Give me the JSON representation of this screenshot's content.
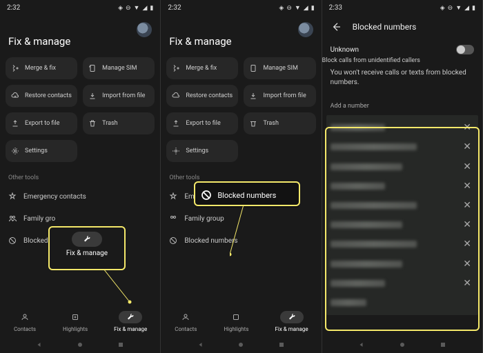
{
  "status": {
    "time1": "2:32",
    "time2": "2:32",
    "time3": "2:33"
  },
  "heading": "Fix & manage",
  "cards": {
    "merge": "Merge & fix",
    "sim": "Manage SIM",
    "restore": "Restore contacts",
    "import": "Import from file",
    "export": "Export to file",
    "trash": "Trash",
    "settings": "Settings"
  },
  "other_label": "Other tools",
  "rows": {
    "emergency": "Emergency contacts",
    "family": "Family group",
    "family_short": "Family gro",
    "blocked": "Blocked numbers",
    "blocked_short": "Blocked n"
  },
  "nav": {
    "contacts": "Contacts",
    "highlights": "Highlights",
    "fix": "Fix & manage"
  },
  "callout1": "Fix & manage",
  "callout2": "Blocked numbers",
  "panel3": {
    "title": "Blocked numbers",
    "unknown": "Unknown",
    "unknown_sub": "Block calls from unidentified callers",
    "info": "You won't receive calls or texts from blocked numbers.",
    "add": "Add a number"
  }
}
